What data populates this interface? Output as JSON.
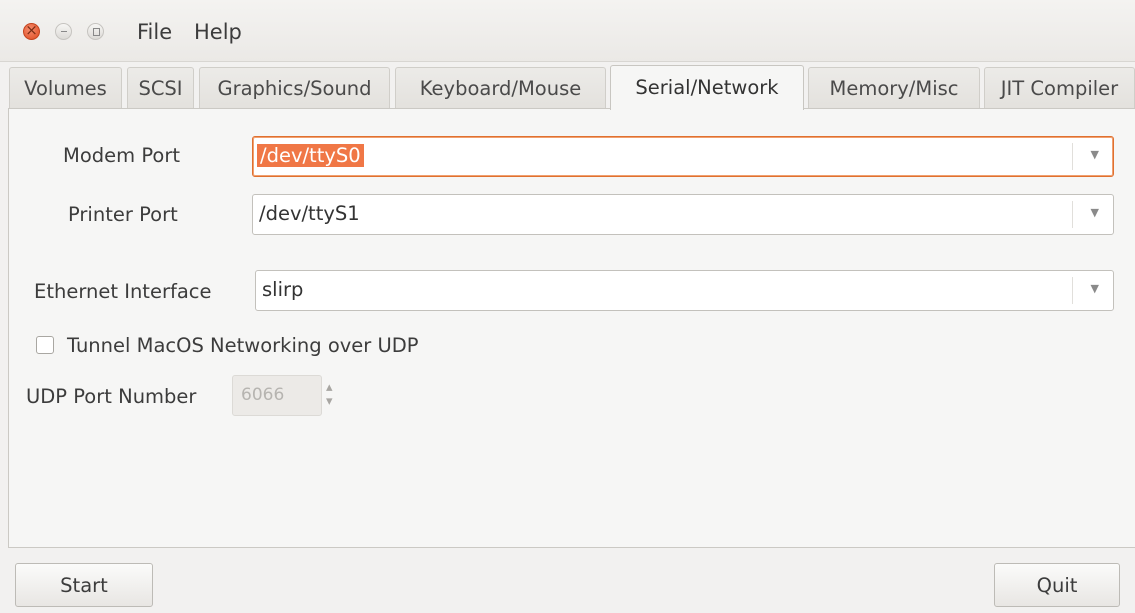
{
  "window": {
    "controls": {
      "close_icon": "close-icon",
      "minimize_icon": "minimize-icon",
      "maximize_icon": "maximize-icon"
    }
  },
  "menubar": {
    "file": "File",
    "help": "Help"
  },
  "tabs": [
    {
      "label": "Volumes"
    },
    {
      "label": "SCSI"
    },
    {
      "label": "Graphics/Sound"
    },
    {
      "label": "Keyboard/Mouse"
    },
    {
      "label": "Serial/Network",
      "active": true
    },
    {
      "label": "Memory/Misc"
    },
    {
      "label": "JIT Compiler"
    }
  ],
  "serial": {
    "modem_port_label": "Modem Port",
    "modem_port_value": "/dev/ttyS0",
    "printer_port_label": "Printer Port",
    "printer_port_value": "/dev/ttyS1"
  },
  "network": {
    "ethernet_label": "Ethernet Interface",
    "ethernet_value": "slirp",
    "tunnel_label": "Tunnel MacOS Networking over UDP",
    "tunnel_checked": false,
    "udp_port_label": "UDP Port Number",
    "udp_port_value": "6066"
  },
  "buttons": {
    "start": "Start",
    "quit": "Quit"
  },
  "colors": {
    "accent": "#f07746",
    "focus_border": "#e0702f",
    "window_bg": "#f2f1f0"
  }
}
